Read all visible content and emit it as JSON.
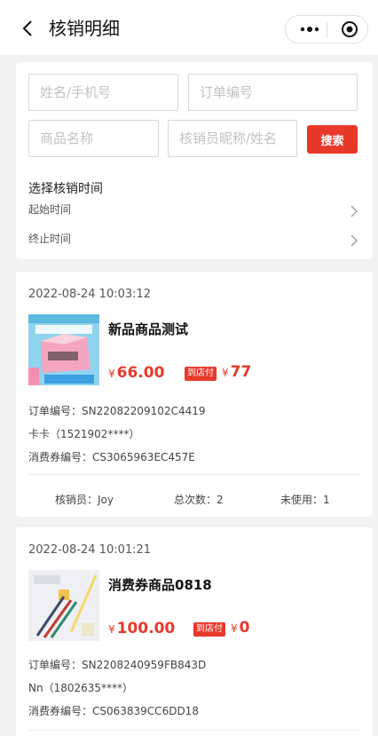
{
  "navbar": {
    "title": "核销明细",
    "back_icon": "chevron-left-icon",
    "more_icon": "more-dots-icon",
    "close_icon": "target-close-icon"
  },
  "search": {
    "name_phone_placeholder": "姓名/手机号",
    "order_no_placeholder": "订单编号",
    "product_name_placeholder": "商品名称",
    "verifier_placeholder": "核销员昵称/姓名",
    "search_button": "搜索",
    "time_title": "选择核销时间",
    "start_time_label": "起始时间",
    "end_time_label": "终止时间"
  },
  "colors": {
    "accent": "#e8382a",
    "background": "#f2f2f2"
  },
  "orders": [
    {
      "date": "2022-08-24 10:03:12",
      "product_name": "新品商品测试",
      "currency": "¥",
      "price": "66.00",
      "store_badge": "到店付",
      "store_price": "77",
      "order_no": "订单编号：SN22082209102C4419",
      "customer": "卡卡（1521902****）",
      "voucher_no": "消费券编号：CS3065963EC457E",
      "verifier": "核销员：Joy",
      "total_times": "总次数：2",
      "unused": "未使用：1"
    },
    {
      "date": "2022-08-24 10:01:21",
      "product_name": "消费券商品0818",
      "currency": "¥",
      "price": "100.00",
      "store_badge": "到店付",
      "store_price": "0",
      "order_no": "订单编号：SN2208240959FB843D",
      "customer": "Nn（1802635****）",
      "voucher_no": "消费券编号：CS063839CC6DD18"
    }
  ]
}
